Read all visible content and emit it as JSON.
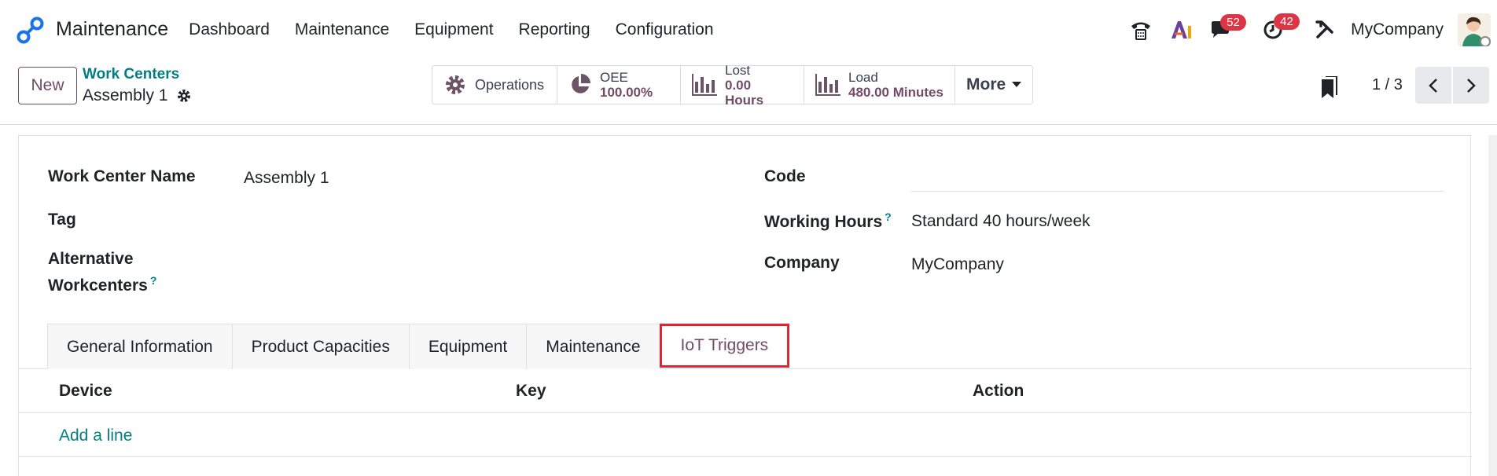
{
  "navbar": {
    "app_name": "Maintenance",
    "menu": [
      "Dashboard",
      "Maintenance",
      "Equipment",
      "Reporting",
      "Configuration"
    ],
    "messages_count": "52",
    "activities_count": "42",
    "company": "MyCompany",
    "icons": [
      "phone-icon",
      "ai-icon",
      "chat-icon",
      "clock-icon",
      "tools-icon",
      "avatar"
    ]
  },
  "control": {
    "new_label": "New",
    "breadcrumb_parent": "Work Centers",
    "breadcrumb_current": "Assembly 1",
    "smart_buttons": {
      "operations": "Operations",
      "oee_label": "OEE",
      "oee_value": "100.00%",
      "lost_label": "Lost",
      "lost_value": "0.00 Hours",
      "load_label": "Load",
      "load_value": "480.00 Minutes",
      "more": "More"
    },
    "pager": "1 / 3"
  },
  "form": {
    "work_center_name_label": "Work Center Name",
    "work_center_name_value": "Assembly 1",
    "tag_label": "Tag",
    "alternative_label_line1": "Alternative",
    "alternative_label_line2": "Workcenters",
    "code_label": "Code",
    "working_hours_label": "Working Hours",
    "working_hours_value": "Standard 40 hours/week",
    "company_label": "Company",
    "company_value": "MyCompany",
    "help_mark": "?"
  },
  "tabs": [
    "General Information",
    "Product Capacities",
    "Equipment",
    "Maintenance",
    "IoT Triggers"
  ],
  "active_tab": "IoT Triggers",
  "table": {
    "columns": [
      "Device",
      "Key",
      "Action"
    ],
    "add_line": "Add a line"
  },
  "colors": {
    "brand": "#714b67",
    "link": "#017e84",
    "badge": "#dc3545",
    "highlight": "#e02530"
  }
}
